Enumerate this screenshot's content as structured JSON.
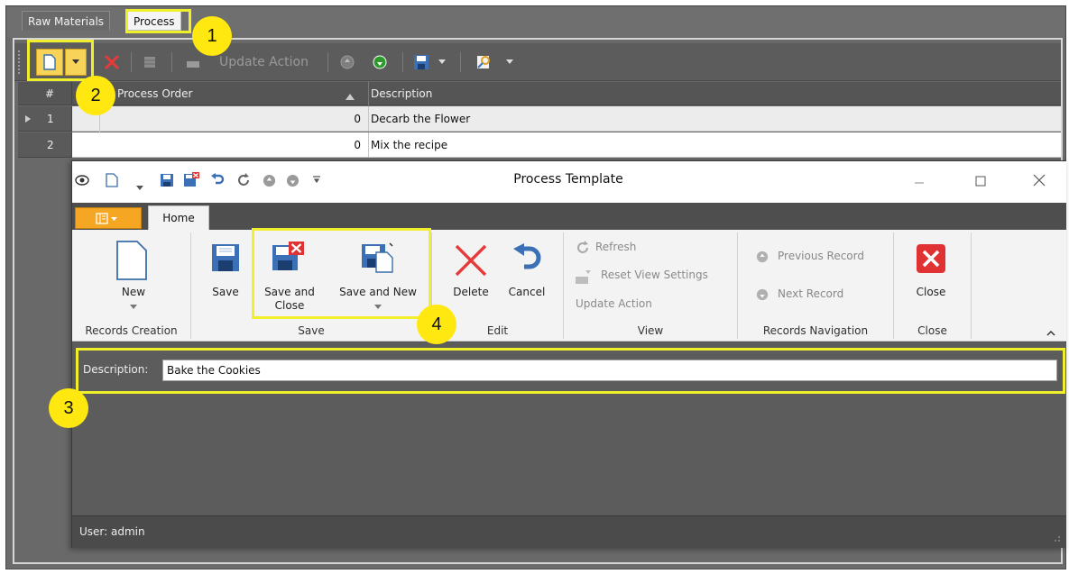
{
  "back": {
    "tabs": [
      {
        "label": "Raw Materials"
      },
      {
        "label": "Process"
      }
    ],
    "toolbar": {
      "update_action_label": "Update Action"
    },
    "grid": {
      "columns": [
        "#",
        "Process Order",
        "Description"
      ],
      "rows": [
        {
          "num": "1",
          "order": "0",
          "description": "Decarb the Flower"
        },
        {
          "num": "2",
          "order": "0",
          "description": "Mix the recipe"
        }
      ]
    }
  },
  "window": {
    "title": "Process Template",
    "tabs": [
      {
        "label": "Home"
      }
    ],
    "ribbon": {
      "groups": {
        "records_creation": "Records Creation",
        "save": "Save",
        "edit": "Edit",
        "view": "View",
        "records_navigation": "Records Navigation",
        "close": "Close"
      },
      "buttons": {
        "new": "New",
        "save": "Save",
        "save_and_close": "Save and Close",
        "save_and_new": "Save and New",
        "delete": "Delete",
        "cancel": "Cancel",
        "refresh": "Refresh",
        "reset_view_settings": "Reset View Settings",
        "update_action": "Update Action",
        "previous_record": "Previous Record",
        "next_record": "Next Record",
        "close": "Close"
      }
    },
    "form": {
      "description_label": "Description:",
      "description_value": "Bake the Cookies"
    },
    "status": "User: admin"
  },
  "callouts": [
    "1",
    "2",
    "3",
    "4"
  ],
  "colors": {
    "highlight": "#f1ef2b",
    "callout": "#ffe80f",
    "accent_tab": "#f5a623",
    "close_red": "#e03232",
    "delete_red": "#e63a3a",
    "save_blue": "#3b6fb6"
  }
}
